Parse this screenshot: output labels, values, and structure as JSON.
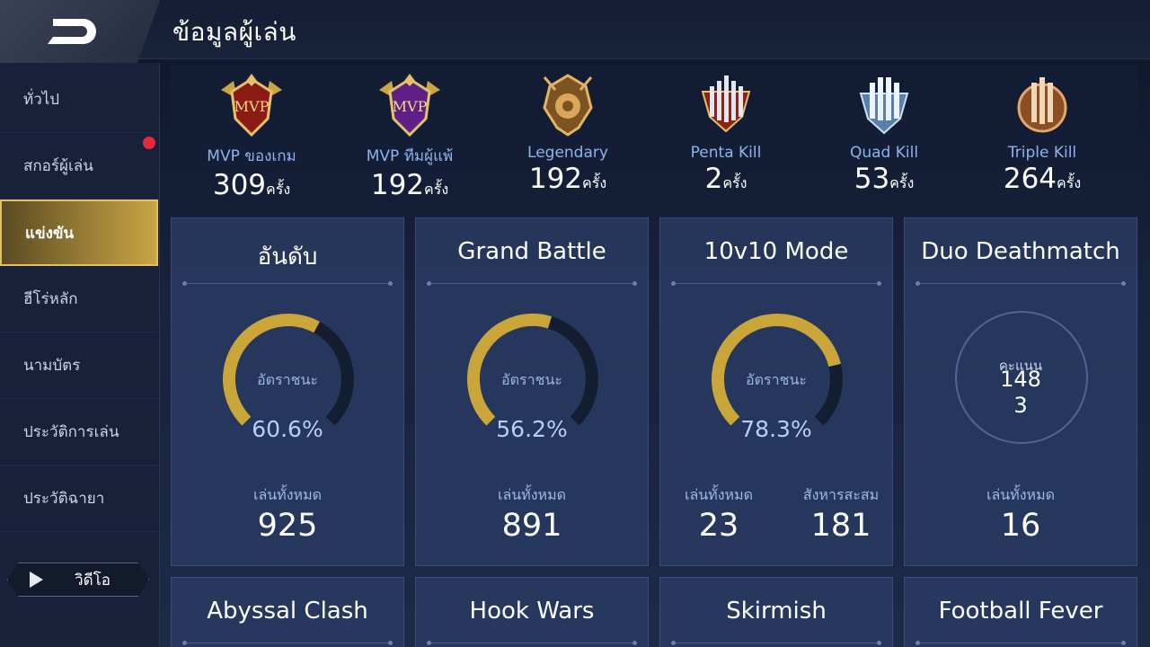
{
  "header": {
    "title": "ข้อมูลผู้เล่น"
  },
  "sidebar": {
    "items": [
      {
        "label": "ทั่วไป"
      },
      {
        "label": "สกอร์ผู้เล่น"
      },
      {
        "label": "แข่งขัน"
      },
      {
        "label": "ฮีโร่หลัก"
      },
      {
        "label": "นามบัตร"
      },
      {
        "label": "ประวัติการเล่น"
      },
      {
        "label": "ประวัติฉายา"
      }
    ],
    "active_index": 2,
    "notification_on": "สกอร์ผู้เล่น",
    "video_label": "วิดีโอ"
  },
  "achievements": [
    {
      "name": "MVP ของเกม",
      "count": "309",
      "unit": "ครั้ง",
      "icon": "mvp-medal-icon",
      "color": "#b32a1e"
    },
    {
      "name": "MVP ทีมผู้แพ้",
      "count": "192",
      "unit": "ครั้ง",
      "icon": "mvp-losing-team-medal-icon",
      "color": "#7a2fa8"
    },
    {
      "name": "Legendary",
      "count": "192",
      "unit": "ครั้ง",
      "icon": "legendary-medal-icon",
      "color": "#c98b3a"
    },
    {
      "name": "Penta Kill",
      "count": "2",
      "unit": "ครั้ง",
      "icon": "penta-kill-medal-icon",
      "color": "#c23a2a"
    },
    {
      "name": "Quad Kill",
      "count": "53",
      "unit": "ครั้ง",
      "icon": "quad-kill-medal-icon",
      "color": "#8fb8e0"
    },
    {
      "name": "Triple Kill",
      "count": "264",
      "unit": "ครั้ง",
      "icon": "triple-kill-medal-icon",
      "color": "#c27a3a"
    }
  ],
  "modes": [
    {
      "title": "อันดับ",
      "win_label": "อัตราชนะ",
      "win_rate": "60.6%",
      "win_fraction": 0.606,
      "stats": [
        {
          "label": "เล่นทั้งหมด",
          "value": "925"
        }
      ]
    },
    {
      "title": "Grand Battle",
      "win_label": "อัตราชนะ",
      "win_rate": "56.2%",
      "win_fraction": 0.562,
      "stats": [
        {
          "label": "เล่นทั้งหมด",
          "value": "891"
        }
      ]
    },
    {
      "title": "10v10 Mode",
      "win_label": "อัตราชนะ",
      "win_rate": "78.3%",
      "win_fraction": 0.783,
      "stats": [
        {
          "label": "เล่นทั้งหมด",
          "value": "23"
        },
        {
          "label": "สังหารสะสม",
          "value": "181"
        }
      ]
    },
    {
      "title": "Duo Deathmatch",
      "score_label": "คะแนน",
      "score_value_line1": "148",
      "score_value_line2": "3",
      "stats": [
        {
          "label": "เล่นทั้งหมด",
          "value": "16"
        }
      ]
    }
  ],
  "more_modes": [
    {
      "title": "Abyssal Clash"
    },
    {
      "title": "Hook Wars"
    },
    {
      "title": "Skirmish"
    },
    {
      "title": "Football Fever"
    }
  ],
  "colors": {
    "gauge_fill": "#c9a53a",
    "gauge_track": "#151d30",
    "accent_gold": "#e2c065",
    "notification_red": "#e8283f"
  }
}
